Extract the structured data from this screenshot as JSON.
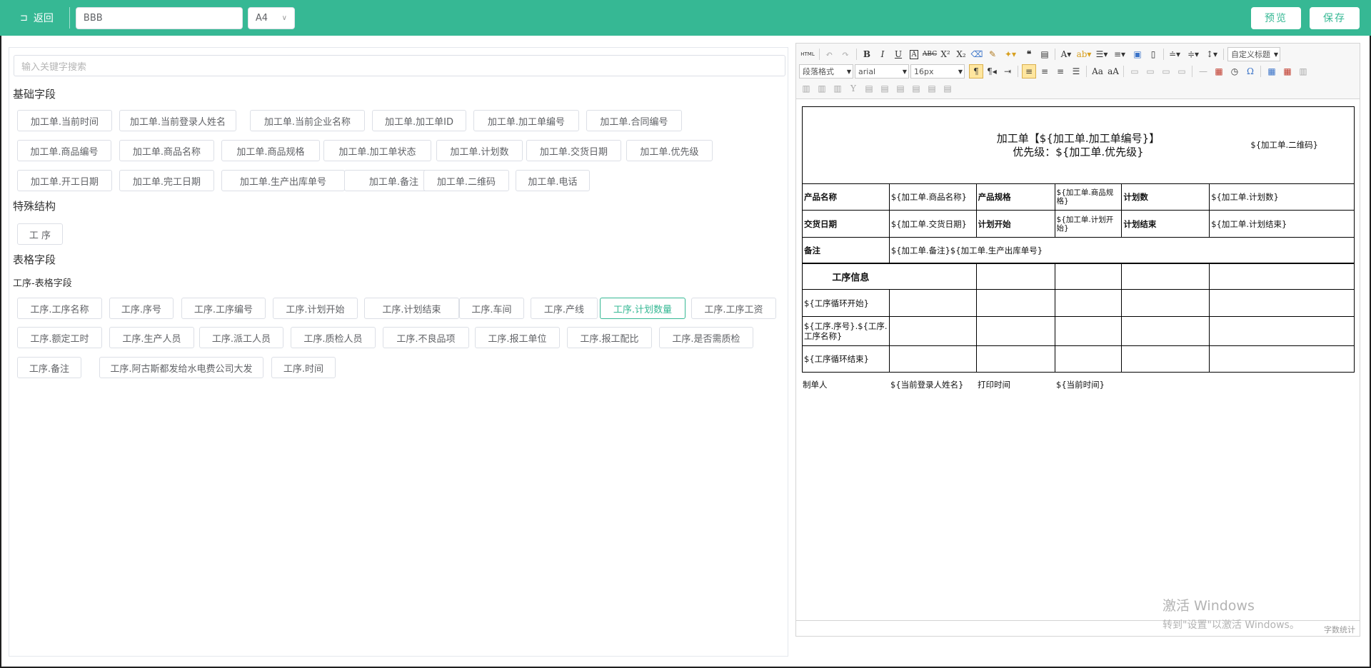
{
  "header": {
    "back_label": "返回",
    "template_name": "BBB",
    "paper_size": "A4",
    "preview_label": "预览",
    "save_label": "保存",
    "bg_color": "#36b894"
  },
  "left": {
    "search_placeholder": "输入关键字搜索",
    "basic_title": "基础字段",
    "basic_tags": [
      "加工单.当前时间",
      "加工单.当前登录人姓名",
      "加工单.当前企业名称",
      "加工单.加工单ID",
      "加工单.加工单编号",
      "加工单.合同编号",
      "加工单.商品编号",
      "加工单.商品名称",
      "加工单.商品规格",
      "加工单.加工单状态",
      "加工单.计划数",
      "加工单.交货日期",
      "加工单.优先级",
      "加工单.开工日期",
      "加工单.完工日期",
      "加工单.生产出库单号",
      "加工单.备注",
      "加工单.二维码",
      "加工单.电话"
    ],
    "special_title": "特殊结构",
    "special_tags": [
      "工 序"
    ],
    "table_title": "表格字段",
    "table_sub": "工序-表格字段",
    "table_tags": [
      "工序.工序名称",
      "工序.序号",
      "工序.工序编号",
      "工序.计划开始",
      "工序.计划结束",
      "工序.车间",
      "工序.产线",
      "工序.计划数量",
      "工序.工序工资",
      "工序.额定工时",
      "工序.生产人员",
      "工序.派工人员",
      "工序.质检人员",
      "工序.不良品项",
      "工序.报工单位",
      "工序.报工配比",
      "工序.是否需质检",
      "工序.备注",
      "工序.阿古斯都发给水电费公司大发",
      "工序.时间"
    ],
    "active_tag": "工序.计划数量"
  },
  "editor": {
    "toolbar": {
      "html": "HTML",
      "paragraph": "段落格式",
      "font": "arial",
      "size": "16px",
      "custom_title": "自定义标题",
      "icon_names": [
        "source-icon",
        "undo-icon",
        "redo-icon",
        "bold-icon",
        "italic-icon",
        "underline-icon",
        "font-border-icon",
        "strikethrough-icon",
        "superscript-icon",
        "subscript-icon",
        "eraser-icon",
        "format-brush-icon",
        "auto-typeset-icon",
        "blockquote-icon",
        "link-icon",
        "emotion-icon"
      ]
    },
    "doc": {
      "title_line1": "加工单【${加工单.加工单编号}】",
      "title_line2": "优先级：${加工单.优先级}",
      "qrcode": "${加工单.二维码}",
      "r1": [
        "产品名称",
        "${加工单.商品名称}",
        "产品规格",
        "${加工单.商品规格}",
        "计划数",
        "${加工单.计划数}"
      ],
      "r2": [
        "交货日期",
        "${加工单.交货日期}",
        "计划开始",
        "${加工单.计划开始}",
        "计划结束",
        "${加工单.计划结束}"
      ],
      "r3": [
        "备注",
        "${加工单.备注}${加工单.生产出库单号}"
      ],
      "section": "工序信息",
      "loop_start": "${工序循环开始}",
      "loop_body": "${工序.序号}.${工序.工序名称}",
      "loop_end": "${工序循环结束}",
      "footer": [
        "制单人",
        "${当前登录人姓名}",
        "打印时间",
        "${当前时间}"
      ]
    },
    "wordcount": "字数统计"
  },
  "watermark": {
    "line1": "激活 Windows",
    "line2": "转到\"设置\"以激活 Windows。"
  }
}
